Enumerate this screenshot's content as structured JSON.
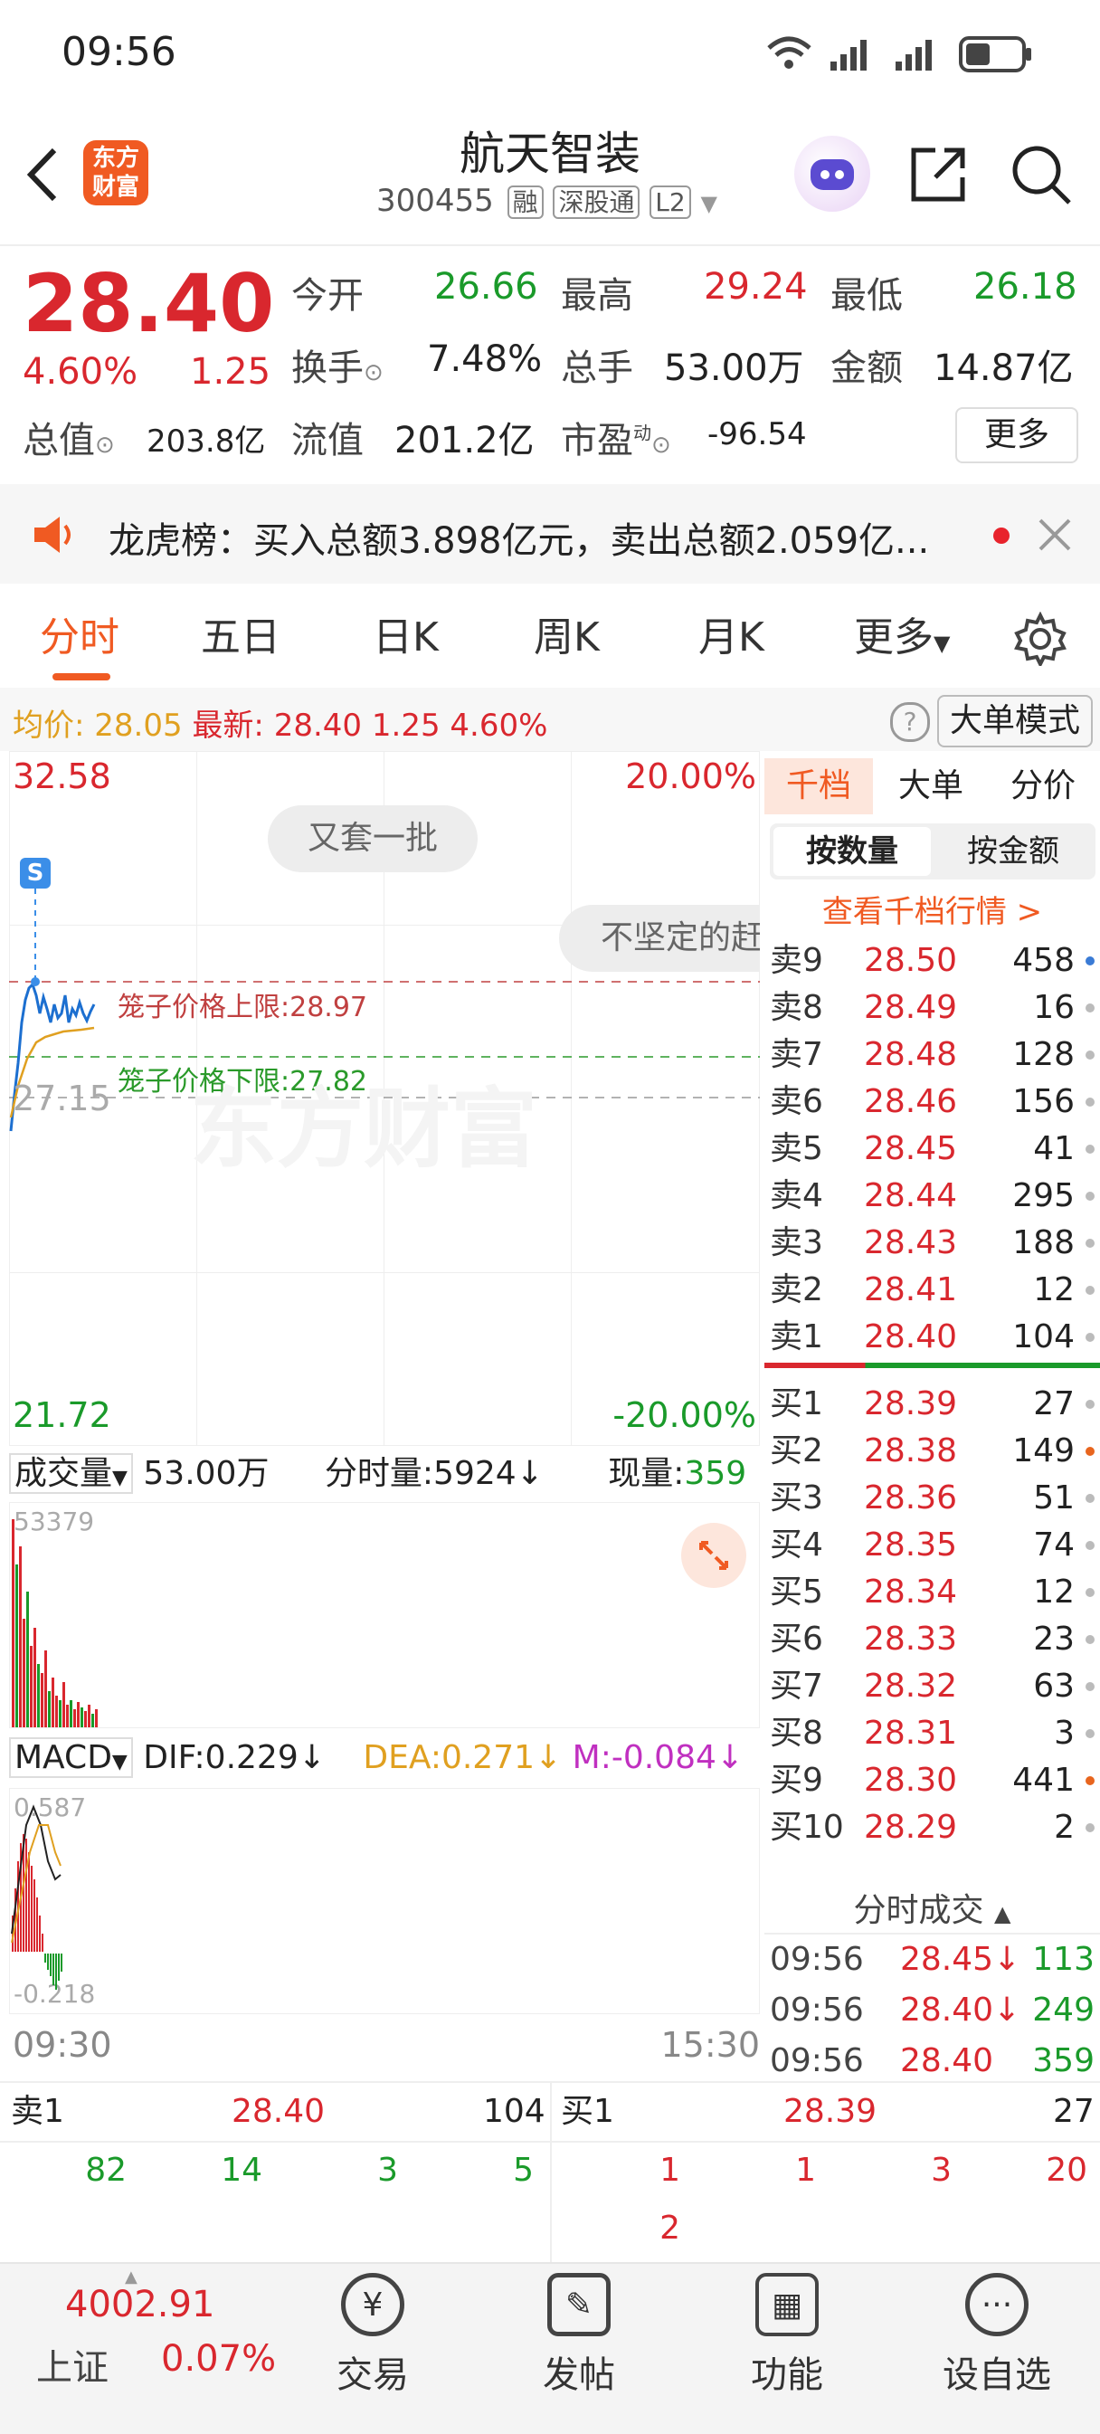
{
  "status": {
    "time": "09:56"
  },
  "header": {
    "stock_name": "航天智装",
    "code": "300455",
    "tags": [
      "融",
      "深股通",
      "L2"
    ],
    "logo_text": "东方财富"
  },
  "quote": {
    "price": "28.40",
    "change_pct": "4.60%",
    "change": "1.25",
    "items": [
      {
        "label": "今开",
        "value": "26.66"
      },
      {
        "label": "最高",
        "value": "29.24"
      },
      {
        "label": "最低",
        "value": "26.18"
      },
      {
        "label": "换手",
        "value": "7.48%"
      },
      {
        "label": "总手",
        "value": "53.00万"
      },
      {
        "label": "金额",
        "value": "14.87亿"
      },
      {
        "label": "总值",
        "value": "203.8亿"
      },
      {
        "label": "流值",
        "value": "201.2亿"
      },
      {
        "label": "市盈",
        "value": "-96.54"
      }
    ],
    "more": "更多"
  },
  "notice": {
    "text": "龙虎榜：买入总额3.898亿元，卖出总额2.059亿..."
  },
  "tabs": [
    "分时",
    "五日",
    "日K",
    "周K",
    "月K",
    "更多"
  ],
  "avg": {
    "avg_label": "均价:",
    "avg_value": "28.05",
    "latest_label": "最新:",
    "latest_value": "28.40",
    "change": "1.25",
    "pct": "4.60%",
    "mode": "大单模式"
  },
  "chart": {
    "high": "32.58",
    "high_pct": "20.00%",
    "low": "21.72",
    "low_pct": "-20.00%",
    "mid": "27.15",
    "bubble1": "又套一批",
    "bubble2": "不坚定的赶",
    "marker": "S",
    "upper_label": "笼子价格上限:",
    "upper_value": "28.97",
    "lower_label": "笼子价格下限:",
    "lower_value": "27.82",
    "watermark": "东方财富",
    "vol_label": "成交量",
    "vol_total": "53.00万",
    "vol_fs_label": "分时量:",
    "vol_fs_value": "5924↓",
    "vol_now_label": "现量:",
    "vol_now_value": "359",
    "vol_max": "53379",
    "macd_label": "MACD",
    "dif": "DIF:0.229↓",
    "dea": "DEA:0.271↓",
    "m": "M:-0.084↓",
    "macd_top": "0.587",
    "macd_bottom": "-0.218",
    "time_start": "09:30",
    "time_end": "15:30"
  },
  "orderbook": {
    "tabs": [
      "千档",
      "大单",
      "分价"
    ],
    "sub_tabs": [
      "按数量",
      "按金额"
    ],
    "link": "查看千档行情 >",
    "sells": [
      {
        "label": "卖9",
        "price": "28.50",
        "vol": "458",
        "dot": "#3a7bd5"
      },
      {
        "label": "卖8",
        "price": "28.49",
        "vol": "16",
        "dot": "#bbbbbb"
      },
      {
        "label": "卖7",
        "price": "28.48",
        "vol": "128",
        "dot": "#bbbbbb"
      },
      {
        "label": "卖6",
        "price": "28.46",
        "vol": "156",
        "dot": "#bbbbbb"
      },
      {
        "label": "卖5",
        "price": "28.45",
        "vol": "41",
        "dot": "#bbbbbb"
      },
      {
        "label": "卖4",
        "price": "28.44",
        "vol": "295",
        "dot": "#bbbbbb"
      },
      {
        "label": "卖3",
        "price": "28.43",
        "vol": "188",
        "dot": "#bbbbbb"
      },
      {
        "label": "卖2",
        "price": "28.41",
        "vol": "12",
        "dot": "#bbbbbb"
      },
      {
        "label": "卖1",
        "price": "28.40",
        "vol": "104",
        "dot": "#bbbbbb"
      }
    ],
    "buys": [
      {
        "label": "买1",
        "price": "28.39",
        "vol": "27",
        "dot": "#bbbbbb"
      },
      {
        "label": "买2",
        "price": "28.38",
        "vol": "149",
        "dot": "#e8651e"
      },
      {
        "label": "买3",
        "price": "28.36",
        "vol": "51",
        "dot": "#bbbbbb"
      },
      {
        "label": "买4",
        "price": "28.35",
        "vol": "74",
        "dot": "#bbbbbb"
      },
      {
        "label": "买5",
        "price": "28.34",
        "vol": "12",
        "dot": "#bbbbbb"
      },
      {
        "label": "买6",
        "price": "28.33",
        "vol": "23",
        "dot": "#bbbbbb"
      },
      {
        "label": "买7",
        "price": "28.32",
        "vol": "63",
        "dot": "#bbbbbb"
      },
      {
        "label": "买8",
        "price": "28.31",
        "vol": "3",
        "dot": "#bbbbbb"
      },
      {
        "label": "买9",
        "price": "28.30",
        "vol": "441",
        "dot": "#e8651e"
      },
      {
        "label": "买10",
        "price": "28.29",
        "vol": "2",
        "dot": "#bbbbbb"
      }
    ],
    "trades_label": "分时成交",
    "trades": [
      {
        "time": "09:56",
        "price": "28.45↓",
        "vol": "113"
      },
      {
        "time": "09:56",
        "price": "28.40↓",
        "vol": "249"
      },
      {
        "time": "09:56",
        "price": "28.40",
        "vol": "359"
      }
    ]
  },
  "bottom_quote": {
    "sell1_label": "卖1",
    "sell1_price": "28.40",
    "sell1_vol": "104",
    "buy1_label": "买1",
    "buy1_price": "28.39",
    "buy1_vol": "27",
    "sell_queue": [
      "82",
      "14",
      "3",
      "5"
    ],
    "buy_queue": [
      "1",
      "1",
      "3",
      "20",
      "2"
    ]
  },
  "bottom_nav": {
    "index_value": "4002.91",
    "index_name": "上证",
    "index_pct": "0.07%",
    "items": [
      "交易",
      "发帖",
      "功能",
      "设自选"
    ]
  }
}
